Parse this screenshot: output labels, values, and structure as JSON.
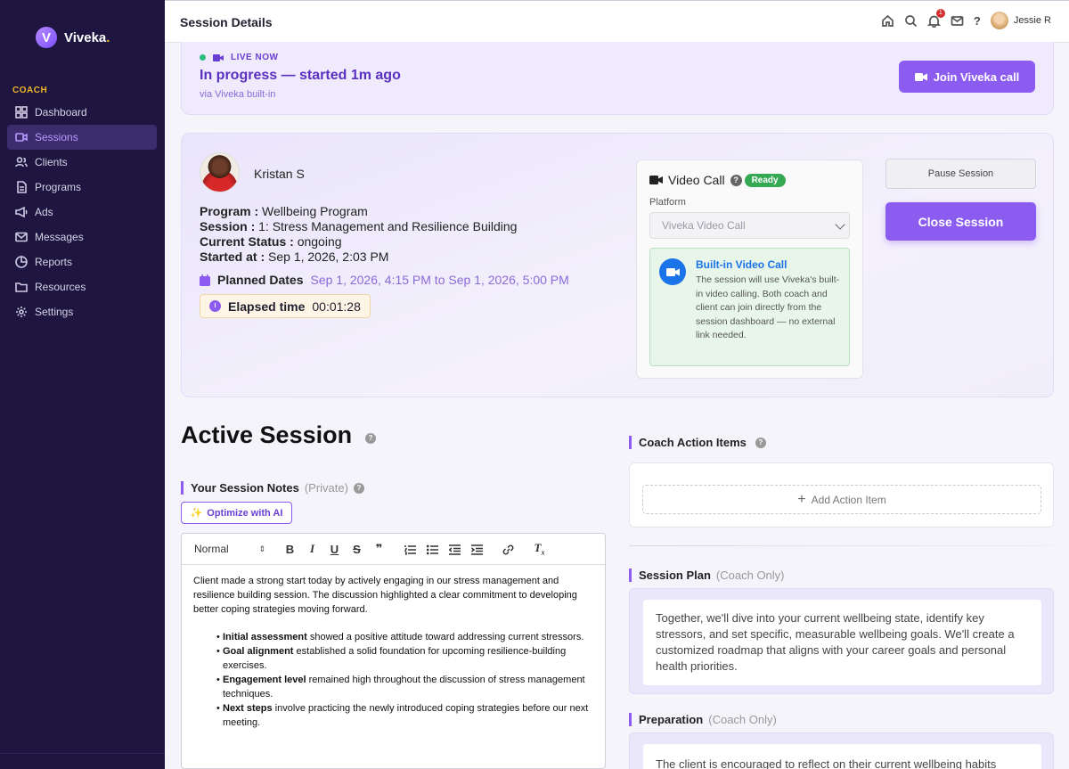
{
  "sidebar": {
    "logo_letter": "V",
    "logo_text": "Viveka",
    "logo_dot": ".",
    "section_label": "COACH",
    "items": [
      {
        "label": "Dashboard",
        "icon": "grid-icon"
      },
      {
        "label": "Sessions",
        "icon": "video-icon"
      },
      {
        "label": "Clients",
        "icon": "users-icon"
      },
      {
        "label": "Programs",
        "icon": "document-icon"
      },
      {
        "label": "Ads",
        "icon": "megaphone-icon"
      },
      {
        "label": "Messages",
        "icon": "mail-icon"
      },
      {
        "label": "Reports",
        "icon": "pie-chart-icon"
      },
      {
        "label": "Resources",
        "icon": "folder-icon"
      },
      {
        "label": "Settings",
        "icon": "gear-icon"
      }
    ],
    "active_index": 1
  },
  "topbar": {
    "title": "Session Details",
    "notification_count": "1",
    "help": "?",
    "user_name": "Jessie R"
  },
  "live": {
    "label": "LIVE NOW",
    "title": "In progress — started 1m ago",
    "subtitle": "via Viveka built-in",
    "join_label": "Join Viveka call"
  },
  "client": {
    "name": "Kristan S",
    "program_label": "Program :",
    "program": "Wellbeing Program",
    "session_label": "Session :",
    "session": "1: Stress Management and Resilience Building",
    "status_label": "Current Status :",
    "status": "ongoing",
    "started_label": "Started at :",
    "started": "Sep 1, 2026, 2:03 PM",
    "planned_label": "Planned Dates",
    "planned": "Sep 1, 2026, 4:15 PM to Sep 1, 2026, 5:00 PM",
    "elapsed_label": "Elapsed time",
    "elapsed": "00:01:28"
  },
  "video_call": {
    "title": "Video Call",
    "help": "?",
    "status": "Ready",
    "platform_label": "Platform",
    "platform_value": "Viveka Video Call",
    "info_title": "Built-in Video Call",
    "info_text": "The session will use Viveka's built-in video calling. Both coach and client can join directly from the session dashboard — no external link needed."
  },
  "actions": {
    "pause_label": "Pause Session",
    "close_label": "Close Session"
  },
  "active_session": {
    "title": "Active Session",
    "help": "?",
    "notes_title": "Your Session Notes",
    "notes_muted": "(Private)",
    "notes_help": "?",
    "optimize_label": "Optimize with AI",
    "editor_format": "Normal",
    "notes_intro": "Client made a strong start today by actively engaging in our stress management and resilience building session. The discussion highlighted a clear commitment to developing better coping strategies moving forward.",
    "bullets": [
      {
        "bold": "Initial assessment",
        "text": " showed a positive attitude toward addressing current stressors."
      },
      {
        "bold": "Goal alignment",
        "text": " established a solid foundation for upcoming resilience-building exercises."
      },
      {
        "bold": "Engagement level",
        "text": " remained high throughout the discussion of stress management techniques."
      },
      {
        "bold": "Next steps",
        "text": " involve practicing the newly introduced coping strategies before our next meeting."
      }
    ]
  },
  "right": {
    "action_items_title": "Coach Action Items",
    "action_items_help": "?",
    "add_action_label": "Add Action Item",
    "plan_title": "Session Plan",
    "plan_muted": "(Coach Only)",
    "plan_text": "Together, we'll dive into your current wellbeing state, identify key stressors, and set specific, measurable wellbeing goals. We'll create a customized roadmap that aligns with your career goals and personal health priorities.",
    "prep_title": "Preparation",
    "prep_muted": "(Coach Only)",
    "prep_text": "The client is encouraged to reflect on their current wellbeing habits"
  }
}
